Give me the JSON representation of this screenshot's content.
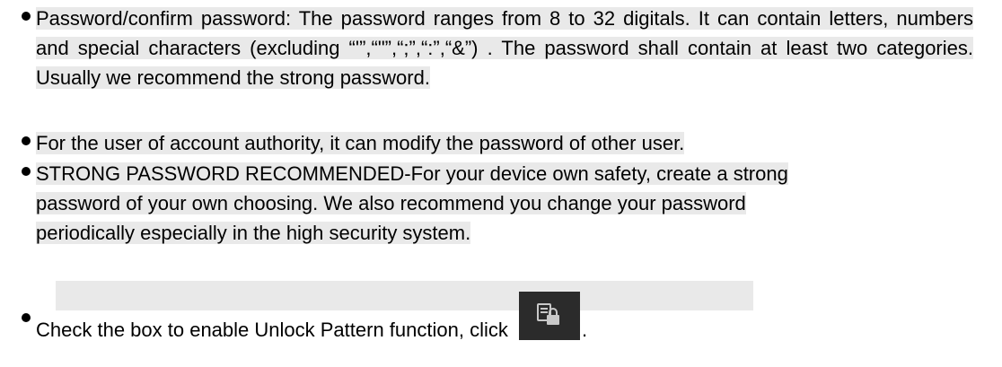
{
  "bullets": [
    {
      "text": "Password/confirm password: The password ranges from 8 to 32 digitals. It can contain letters, numbers and special characters (excluding “'”,“\"”,“;”,“:”,“&”) . The password shall contain at least two categories. Usually we recommend the strong password."
    },
    {
      "text": "For the user of account authority, it can modify the password of other user."
    },
    {
      "text": "STRONG PASSWORD RECOMMENDED-For your device own safety, create a strong password of your own choosing. We also recommend you change your password periodically especially in the high security system."
    },
    {
      "text": "Check the box to enable Unlock Pattern function, click",
      "icon": "unlock-pattern-icon",
      "trailing": "."
    }
  ],
  "colors": {
    "highlight": "#e9e9e9",
    "icon_bg": "#2b2b2b"
  }
}
